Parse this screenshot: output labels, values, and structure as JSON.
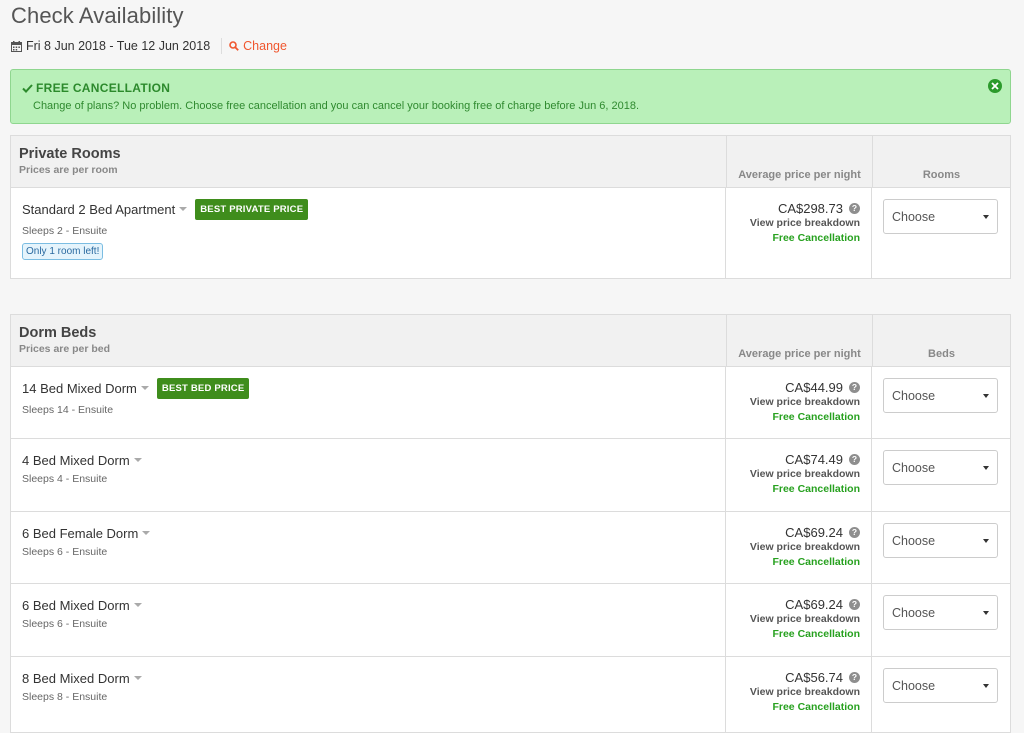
{
  "header": {
    "title": "Check Availability",
    "dates": "Fri 8 Jun 2018 - Tue 12 Jun 2018",
    "change_label": "Change"
  },
  "alert": {
    "title": "FREE CANCELLATION",
    "text": "Change of plans? No problem. Choose free cancellation and you can cancel your booking free of charge before Jun 6, 2018."
  },
  "private": {
    "title": "Private Rooms",
    "subtitle": "Prices are per room",
    "price_col": "Average price per night",
    "qty_col": "Rooms",
    "rooms": [
      {
        "name": "Standard 2 Bed Apartment",
        "badge": "BEST PRIVATE PRICE",
        "meta": "Sleeps 2 - Ensuite",
        "notice": "Only 1 room left!",
        "price": "CA$298.73",
        "breakdown": "View price breakdown",
        "cancel": "Free Cancellation",
        "select": "Choose"
      }
    ]
  },
  "dorms": {
    "title": "Dorm Beds",
    "subtitle": "Prices are per bed",
    "price_col": "Average price per night",
    "qty_col": "Beds",
    "rooms": [
      {
        "name": "14 Bed Mixed Dorm",
        "badge": "BEST BED PRICE",
        "meta": "Sleeps 14 - Ensuite",
        "price": "CA$44.99",
        "breakdown": "View price breakdown",
        "cancel": "Free Cancellation",
        "select": "Choose"
      },
      {
        "name": "4 Bed Mixed Dorm",
        "meta": "Sleeps 4 - Ensuite",
        "price": "CA$74.49",
        "breakdown": "View price breakdown",
        "cancel": "Free Cancellation",
        "select": "Choose"
      },
      {
        "name": "6 Bed Female Dorm",
        "meta": "Sleeps 6 - Ensuite",
        "price": "CA$69.24",
        "breakdown": "View price breakdown",
        "cancel": "Free Cancellation",
        "select": "Choose"
      },
      {
        "name": "6 Bed Mixed Dorm",
        "meta": "Sleeps 6 - Ensuite",
        "price": "CA$69.24",
        "breakdown": "View price breakdown",
        "cancel": "Free Cancellation",
        "select": "Choose"
      },
      {
        "name": "8 Bed Mixed Dorm",
        "meta": "Sleeps 8 - Ensuite",
        "price": "CA$56.74",
        "breakdown": "View price breakdown",
        "cancel": "Free Cancellation",
        "select": "Choose"
      }
    ]
  },
  "icons": {
    "calendar": "calendar-icon",
    "search": "search-icon",
    "check": "check-icon",
    "close": "close-circle-icon",
    "help": "question-circle-icon"
  },
  "colors": {
    "accent_orange": "#f0572f",
    "alert_bg": "#b9f0b9",
    "badge_green": "#3f8d1c",
    "free_cancel_green": "#27a11f"
  }
}
